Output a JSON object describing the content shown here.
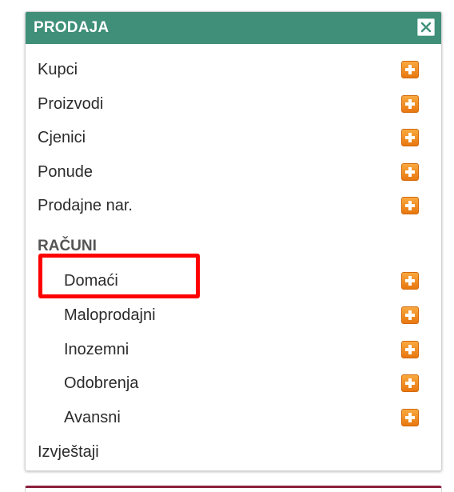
{
  "panel": {
    "title": "PRODAJA",
    "close_icon": "close-icon",
    "header_color": "#3f8f79",
    "accent_plus_color": "#f08a1c",
    "highlight_color": "#ff0000"
  },
  "menu": {
    "items": [
      {
        "label": "Kupci",
        "icon": "plus-icon"
      },
      {
        "label": "Proizvodi",
        "icon": "plus-icon"
      },
      {
        "label": "Cjenici",
        "icon": "plus-icon"
      },
      {
        "label": "Ponude",
        "icon": "plus-icon"
      },
      {
        "label": "Prodajne nar.",
        "icon": "plus-icon"
      }
    ],
    "section": {
      "heading": "RAČUNI",
      "items": [
        {
          "label": "Domaći",
          "icon": "plus-icon",
          "highlighted": true
        },
        {
          "label": "Maloprodajni",
          "icon": "plus-icon"
        },
        {
          "label": "Inozemni",
          "icon": "plus-icon"
        },
        {
          "label": "Odobrenja",
          "icon": "plus-icon"
        },
        {
          "label": "Avansni",
          "icon": "plus-icon"
        }
      ]
    },
    "footer_item": {
      "label": "Izvještaji"
    }
  }
}
